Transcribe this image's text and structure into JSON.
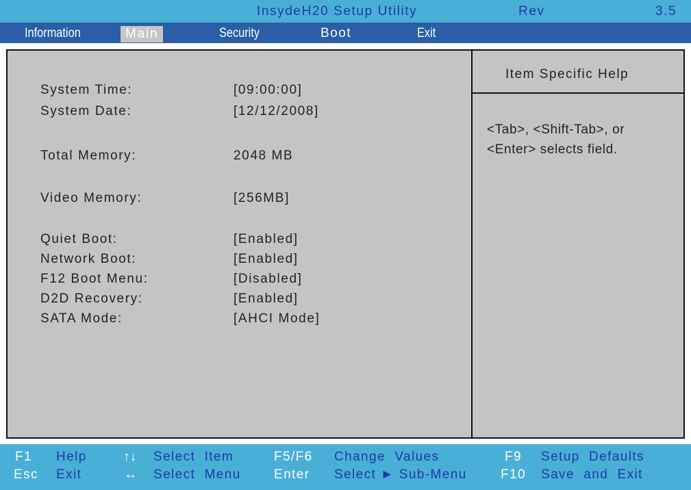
{
  "title_bar": {
    "title": "InsydeH20 Setup Utility",
    "rev_label": "Rev",
    "rev_value": "3.5"
  },
  "menu": {
    "tabs": [
      "Information",
      "Main",
      "Security",
      "Boot",
      "Exit"
    ],
    "selected": "Main"
  },
  "main": {
    "rows": [
      {
        "label": "System Time:",
        "value": "[09:00:00]"
      },
      {
        "label": "System Date:",
        "value": "[12/12/2008]"
      },
      {
        "label": "Total Memory:",
        "value": "2048 MB"
      },
      {
        "label": "Video Memory:",
        "value": "[256MB]"
      },
      {
        "label": "Quiet Boot:",
        "value": "[Enabled]"
      },
      {
        "label": "Network Boot:",
        "value": "[Enabled]"
      },
      {
        "label": "F12 Boot Menu:",
        "value": "[Disabled]"
      },
      {
        "label": "D2D Recovery:",
        "value": "[Enabled]"
      },
      {
        "label": "SATA Mode:",
        "value": "[AHCI Mode]"
      }
    ]
  },
  "help": {
    "title": "Item Specific Help",
    "line1": "<Tab>, <Shift-Tab>, or",
    "line2": "<Enter> selects field."
  },
  "footer": {
    "row1": {
      "k1": "F1",
      "d1": "Help",
      "k2": "↑↓",
      "d2": "Select  Item",
      "k3": "F5/F6",
      "d3": "Change  Values",
      "k4": "F9",
      "d4": "Setup  Defaults"
    },
    "row2": {
      "k1": "Esc",
      "d1": "Exit",
      "k2": "↔",
      "d2": "Select  Menu",
      "k3": "Enter",
      "d3": "Select ► Sub-Menu",
      "k4": "F10",
      "d4": "Save  and  Exit"
    }
  },
  "colors": {
    "bar": "#49afd6",
    "menubar": "#2a5ea6",
    "panel": "#c3c4c6",
    "text_blue": "#1e3aa8"
  }
}
